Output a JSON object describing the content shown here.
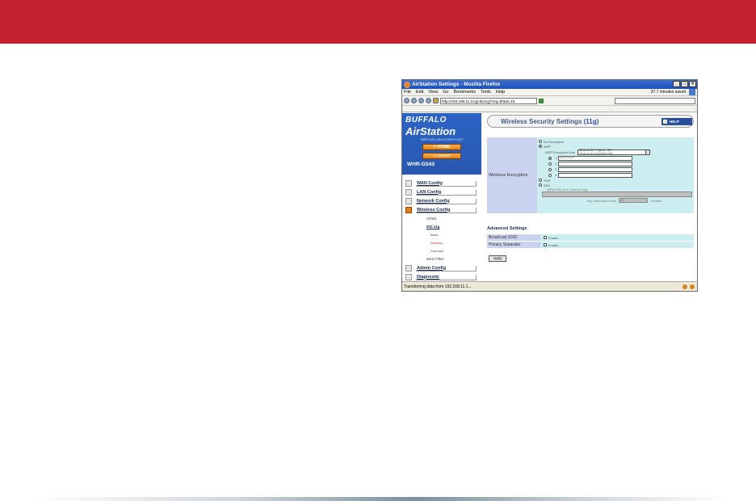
{
  "window": {
    "title": "AirStation Settings - Mozilla Firefox",
    "controls": [
      "_",
      "□",
      "×"
    ]
  },
  "menubar": {
    "items": [
      "File",
      "Edit",
      "View",
      "Go",
      "Bookmarks",
      "Tools",
      "Help"
    ],
    "saved_text": "37.7 minutes saved"
  },
  "navbar": {
    "url": "http://192.168.11.1/cgi-bin/cgi?req=tfr&id=15"
  },
  "sidebar": {
    "brand": "BUFFALO",
    "product": "AirStation",
    "tagline": "WIRELESS LAN ACCESS POINT",
    "home_label": "HOME",
    "logout_label": "LOGOUT",
    "model": "WHR-G54S",
    "menu": [
      {
        "label": "WAN Config",
        "active": false
      },
      {
        "label": "LAN Config",
        "active": false
      },
      {
        "label": "Network Config",
        "active": false
      },
      {
        "label": "Wireless Config",
        "active": true
      }
    ],
    "sub": {
      "aoss": "AOSS",
      "std": "802.11g",
      "basic": "Basic",
      "security": "Security",
      "repeater": "Repeater",
      "macfilter": "MAC Filter"
    },
    "menu2": [
      {
        "label": "Admin Config"
      },
      {
        "label": "Diagnostic"
      }
    ]
  },
  "main": {
    "title_prefix": "Wireless Security Settings (",
    "title_highlight": "11g",
    "title_suffix": ")",
    "help_label": "HELP",
    "wireless_encryption_label": "Wireless Encryption",
    "options": {
      "no_encryption": "No Encryption",
      "wep": "WEP",
      "wep_key_label": "WEP Encryption Key",
      "wep_key_select": "Character Input : 13 characters(WEP128)",
      "keys": [
        {
          "num": "1",
          "value": "*************"
        },
        {
          "num": "2",
          "value": ""
        },
        {
          "num": "3",
          "value": ""
        },
        {
          "num": "4",
          "value": ""
        }
      ],
      "tkip": "TKIP",
      "aes": "AES",
      "psk_label": "WPA-PSK (Pre-Shared Key)",
      "renewal_label": "Key Renewal Period",
      "renewal_value": "60",
      "renewal_unit": "minutes"
    },
    "advanced_title": "Advanced Settings",
    "broadcast_label": "Broadcast SSID",
    "privacy_label": "Privacy Separator",
    "enable_label": "Enable",
    "apply_label": "Apply"
  },
  "status": {
    "text": "Transferring data from 192.168.11.1..."
  },
  "colors": {
    "top_band": "#c2202e",
    "sidebar_blue": "#2a5cb8",
    "home_orange": "#e07d1a"
  }
}
